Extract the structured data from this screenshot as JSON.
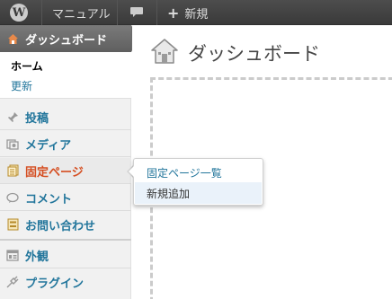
{
  "adminbar": {
    "logo_icon": "wordpress-logo-icon",
    "logo_glyph": "W",
    "manual": "マニュアル",
    "comment_icon": "comment-bubble-icon",
    "new_plus": "+",
    "new_label": "新規"
  },
  "sidebar": {
    "dashboard": {
      "label": "ダッシュボード",
      "icon": "home-icon"
    },
    "submenu": {
      "home": "ホーム",
      "update": "更新"
    },
    "items": [
      {
        "label": "投稿",
        "icon": "pin-icon"
      },
      {
        "label": "メディア",
        "icon": "media-icon"
      },
      {
        "label": "固定ページ",
        "icon": "pages-icon"
      },
      {
        "label": "コメント",
        "icon": "comment-icon"
      },
      {
        "label": "お問い合わせ",
        "icon": "contact-form-icon"
      },
      {
        "label": "外観",
        "icon": "appearance-icon"
      },
      {
        "label": "プラグイン",
        "icon": "plugin-icon"
      }
    ]
  },
  "flyout": {
    "all_pages": "固定ページ一覧",
    "add_new": "新規追加"
  },
  "main": {
    "title": "ダッシュボード",
    "title_icon": "home-icon"
  },
  "colors": {
    "adminbar_bg": "#464646",
    "link": "#21759b",
    "active_menu": "#d54e21",
    "dashboard_bg": "#6a6a6a"
  }
}
